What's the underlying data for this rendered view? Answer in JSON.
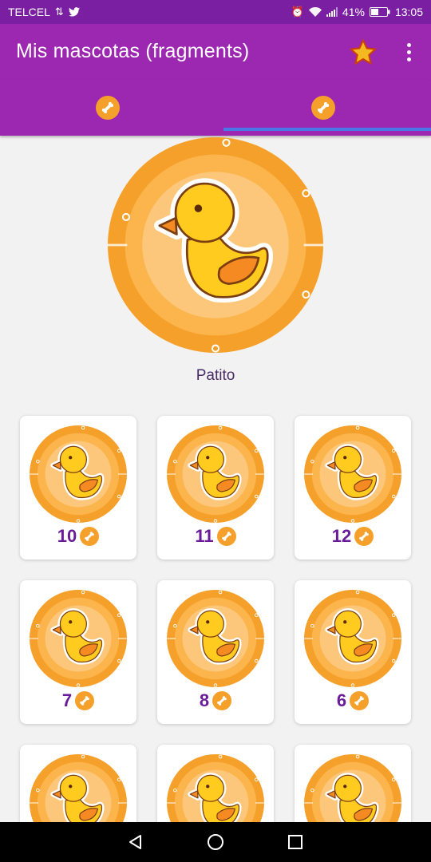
{
  "status_bar": {
    "carrier": "TELCEL",
    "battery": "41%",
    "time": "13:05"
  },
  "app_bar": {
    "title": "Mis mascotas (fragments)",
    "actions": [
      "star-icon",
      "overflow-menu-icon"
    ]
  },
  "tabs": [
    {
      "icon": "bone-icon",
      "selected": false
    },
    {
      "icon": "bone-icon",
      "selected": true
    }
  ],
  "colors": {
    "primary": "#9c27b0",
    "primary_dark": "#7b1fa2",
    "accent_indicator": "#4a78e8",
    "medal_orange": "#f5a02a",
    "duck_yellow": "#ffcb1f",
    "count_purple": "#6a1b9a"
  },
  "hero": {
    "name": "Patito",
    "image": "duck-medal-icon"
  },
  "grid": {
    "cards": [
      {
        "count": "10"
      },
      {
        "count": "11"
      },
      {
        "count": "12"
      },
      {
        "count": "7"
      },
      {
        "count": "8"
      },
      {
        "count": "6"
      },
      {
        "count": ""
      },
      {
        "count": ""
      },
      {
        "count": ""
      }
    ]
  },
  "nav_bar": [
    "back-icon",
    "home-icon",
    "recents-icon"
  ]
}
